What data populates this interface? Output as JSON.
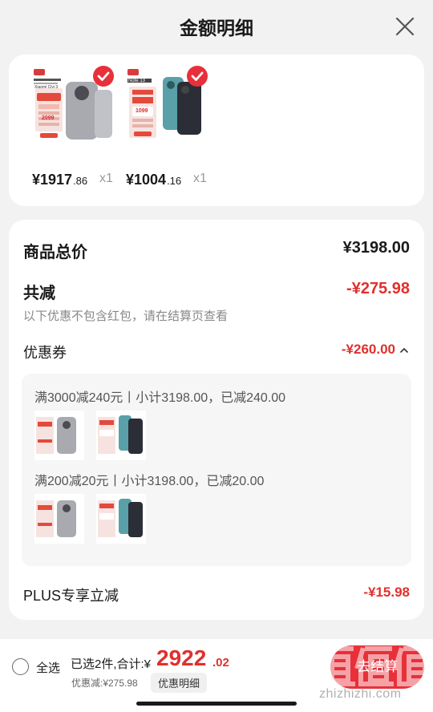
{
  "header": {
    "title": "金额明细"
  },
  "products": [
    {
      "name": "Xiaomi Civi 3",
      "thumb_label": "Xiaomi Civi 3",
      "thumb_price": "2099",
      "price_int": "¥1917",
      "price_dec": ".86",
      "qty": "x1",
      "phone_color": "#a8aab0"
    },
    {
      "name": "Note 13",
      "thumb_label": "Note 13",
      "thumb_price": "1099",
      "price_int": "¥1004",
      "price_dec": ".16",
      "qty": "x1",
      "phone_color": "#5aa0a8"
    }
  ],
  "details": {
    "subtotal_label": "商品总价",
    "subtotal_value": "¥3198.00",
    "discount_label": "共减",
    "discount_value": "-¥275.98",
    "discount_note": "以下优惠不包含红包，请在结算页查看",
    "coupon_label": "优惠券",
    "coupon_value": "-¥260.00",
    "coupons": [
      {
        "title": "满3000减240元丨小计3198.00，已减240.00"
      },
      {
        "title": "满200减20元丨小计3198.00，已减20.00"
      }
    ],
    "plus_label": "PLUS专享立减",
    "plus_value": "-¥15.98"
  },
  "bottom": {
    "select_all": "全选",
    "summary": "已选2件,合计:¥",
    "total_int": "2922",
    "total_dec": ".02",
    "saved": "优惠减:¥275.98",
    "detail_chip": "优惠明细",
    "checkout": "去结算",
    "watermark_text": "zhizhizhi.com"
  },
  "colors": {
    "accent": "#e0302d",
    "background": "#f2f2f2"
  }
}
